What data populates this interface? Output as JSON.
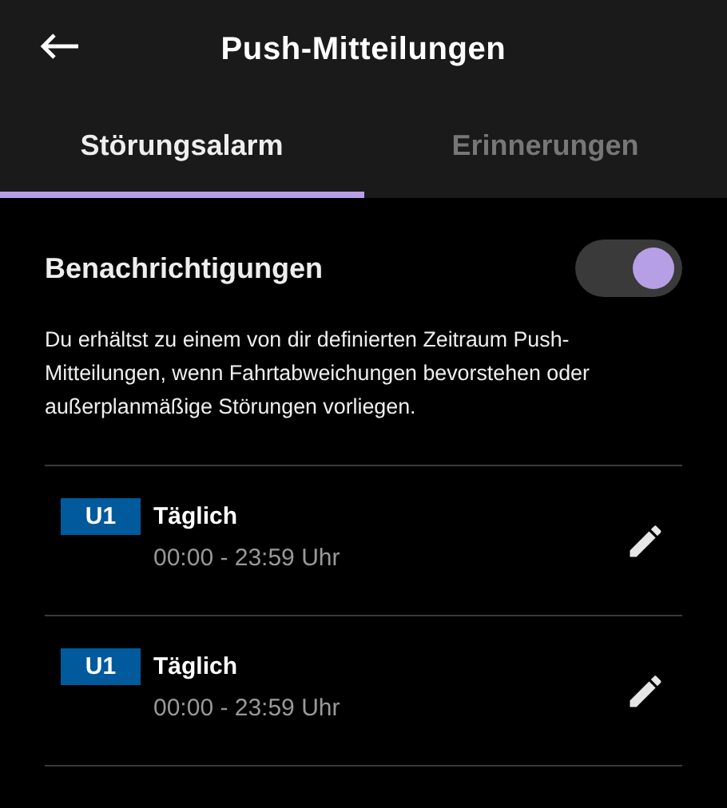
{
  "header": {
    "title": "Push-Mitteilungen"
  },
  "tabs": [
    {
      "label": "Störungsalarm",
      "selected": true
    },
    {
      "label": "Erinnerungen",
      "selected": false
    }
  ],
  "notifications": {
    "label": "Benachrichtigungen",
    "on": true,
    "description": "Du erhältst zu einem von dir definierten Zeitraum Push-Mitteilungen, wenn Fahrtabweichungen bevorstehen oder außerplanmäßige Störungen vorliegen."
  },
  "alarms": [
    {
      "line": "U1",
      "color": "#005a9c",
      "title": "Täglich",
      "time": "00:00 - 23:59 Uhr"
    },
    {
      "line": "U1",
      "color": "#005a9c",
      "title": "Täglich",
      "time": "00:00 - 23:59 Uhr"
    }
  ]
}
